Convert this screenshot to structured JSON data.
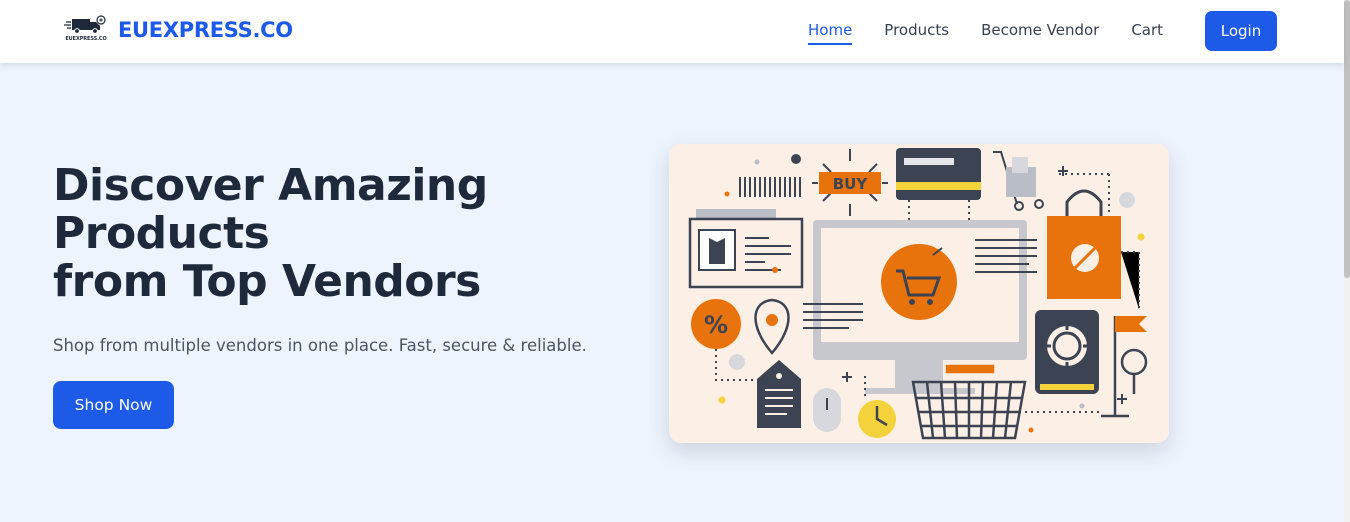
{
  "brand": {
    "logo_text": "EUEXPRESS.CO",
    "name": "EUEXPRESS.CO",
    "color": "#1d5ae8"
  },
  "nav": {
    "items": [
      {
        "label": "Home",
        "active": true
      },
      {
        "label": "Products",
        "active": false
      },
      {
        "label": "Become Vendor",
        "active": false
      },
      {
        "label": "Cart",
        "active": false
      }
    ],
    "login_label": "Login"
  },
  "hero": {
    "title_lines": [
      "Discover Amazing",
      "Products",
      "from Top Vendors"
    ],
    "subtitle": "Shop from multiple vendors in one place. Fast, secure & reliable.",
    "cta_label": "Shop Now",
    "illustration": {
      "buy_label": "BUY",
      "percent_label": "%",
      "icons": [
        "shopping-cart-icon",
        "shopping-bag-icon",
        "credit-card-icon",
        "basket-icon",
        "clock-icon",
        "safe-icon",
        "location-pin-icon",
        "price-tag-icon",
        "hand-truck-icon",
        "flag-icon",
        "mouse-icon"
      ]
    }
  },
  "colors": {
    "primary": "#1d5ae8",
    "hero_background": "#eef4fe",
    "illustration_background": "#fcefe5",
    "illustration_accent": "#e8730c",
    "illustration_dark": "#3c4352"
  }
}
